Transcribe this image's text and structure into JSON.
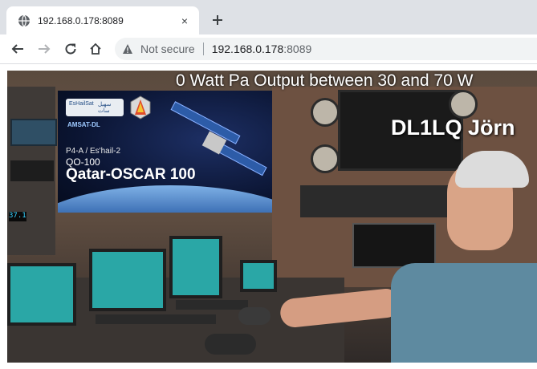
{
  "browser": {
    "tab": {
      "title": "192.168.0.178:8089",
      "favicon": "globe-icon",
      "close": "×"
    },
    "new_tab": "plus-icon",
    "nav": {
      "back": "arrow-left-icon",
      "forward": "arrow-right-icon",
      "reload": "reload-icon",
      "home": "home-icon"
    },
    "omnibox": {
      "security_icon": "warning-triangle-icon",
      "security_label": "Not secure",
      "url_host": "192.168.0.178",
      "url_port": ":8089"
    }
  },
  "stream": {
    "banner_text": "0 Watt Pa   Output between 30 and 70 W",
    "callsign": "DL1LQ Jörn",
    "frequency_display": "37.1",
    "overlay": {
      "logo_left": "EsHailSat",
      "logo_right": "سهيل سات",
      "amsat": "AMSAT-DL",
      "subtitle": "P4-A / Es'hail-2",
      "designation": "QO-100",
      "title": "Qatar-OSCAR 100"
    }
  }
}
